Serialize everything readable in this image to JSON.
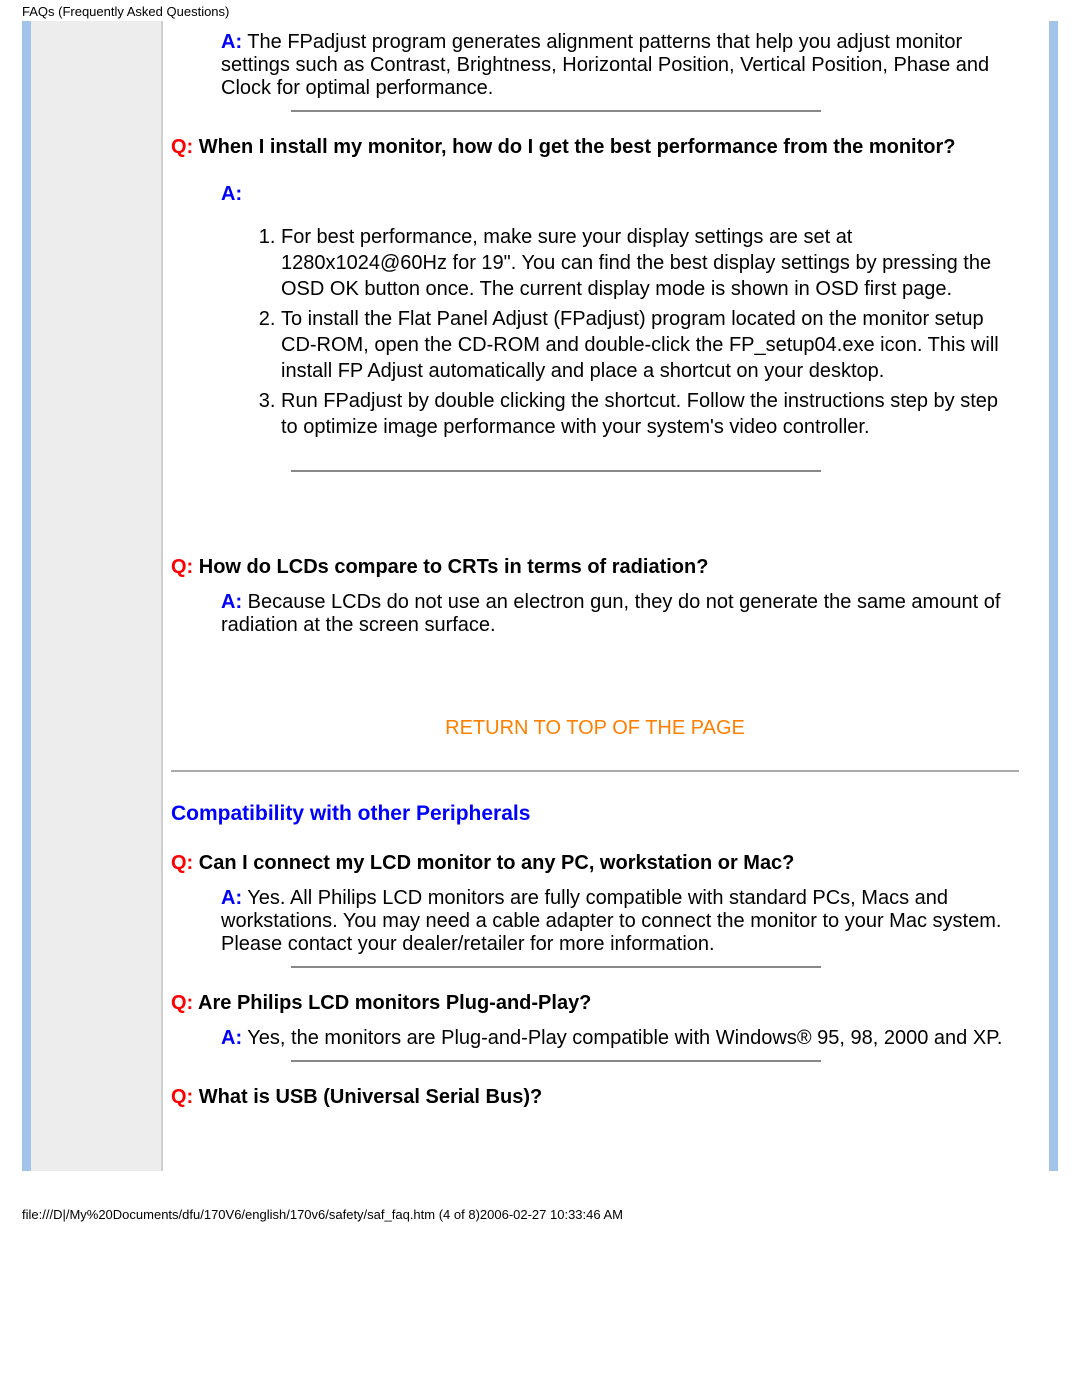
{
  "header": "FAQs (Frequently Asked Questions)",
  "qa": {
    "a0_label": "A:",
    "a0_text": " The FPadjust program generates alignment patterns that help you adjust monitor settings such as Contrast, Brightness, Horizontal Position, Vertical Position, Phase and Clock for optimal performance.",
    "q1_label": "Q:",
    "q1_text": " When I install my monitor, how do I get the best performance from the monitor?",
    "a1_label": "A:",
    "steps": {
      "s1": "For best performance, make sure your display settings are set at 1280x1024@60Hz for 19\". You can find the best display settings by pressing the OSD OK button once. The current display mode is shown in OSD first page.",
      "s2": "To install the Flat Panel Adjust (FPadjust) program located on the monitor setup CD-ROM, open the CD-ROM and double-click the FP_setup04.exe icon. This will install FP Adjust automatically and place a shortcut on your desktop.",
      "s3": "Run FPadjust by double clicking the shortcut. Follow the instructions step by step to optimize image performance with your system's video controller."
    },
    "q2_label": "Q:",
    "q2_text": " How do LCDs compare to CRTs in terms of radiation?",
    "a2_label": "A:",
    "a2_text": " Because LCDs do not use an electron gun, they do not generate the same amount of radiation at the screen surface.",
    "return_link": "RETURN TO TOP OF THE PAGE",
    "section_title": "Compatibility with other Peripherals",
    "q3_label": "Q:",
    "q3_text": " Can I connect my LCD monitor to any PC, workstation or Mac?",
    "a3_label": "A:",
    "a3_text": " Yes. All Philips LCD monitors are fully compatible with standard PCs, Macs and workstations. You may need a cable adapter to connect the monitor to your Mac system. Please contact your dealer/retailer for more information.",
    "q4_label": "Q:",
    "q4_text": " Are Philips LCD monitors Plug-and-Play?",
    "a4_label": "A:",
    "a4_text": " Yes, the monitors are Plug-and-Play compatible with Windows® 95, 98, 2000 and XP.",
    "q5_label": "Q:",
    "q5_text": " What is USB (Universal Serial Bus)?"
  },
  "footer": "file:///D|/My%20Documents/dfu/170V6/english/170v6/safety/saf_faq.htm (4 of 8)2006-02-27 10:33:46 AM"
}
